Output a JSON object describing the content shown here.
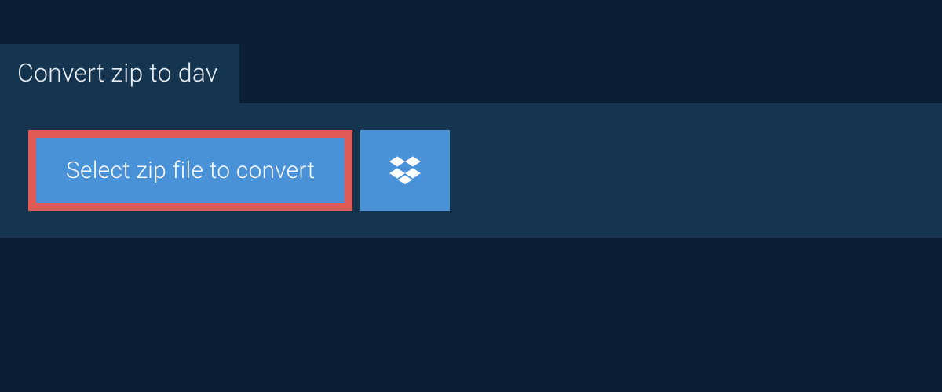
{
  "tab": {
    "label": "Convert zip to dav"
  },
  "buttons": {
    "select_label": "Select zip file to convert"
  },
  "colors": {
    "page_bg": "#0b1e33",
    "panel_bg": "#14344f",
    "button_bg": "#4a92d7",
    "highlight_border": "#e05a56",
    "text": "#e8eef3"
  }
}
